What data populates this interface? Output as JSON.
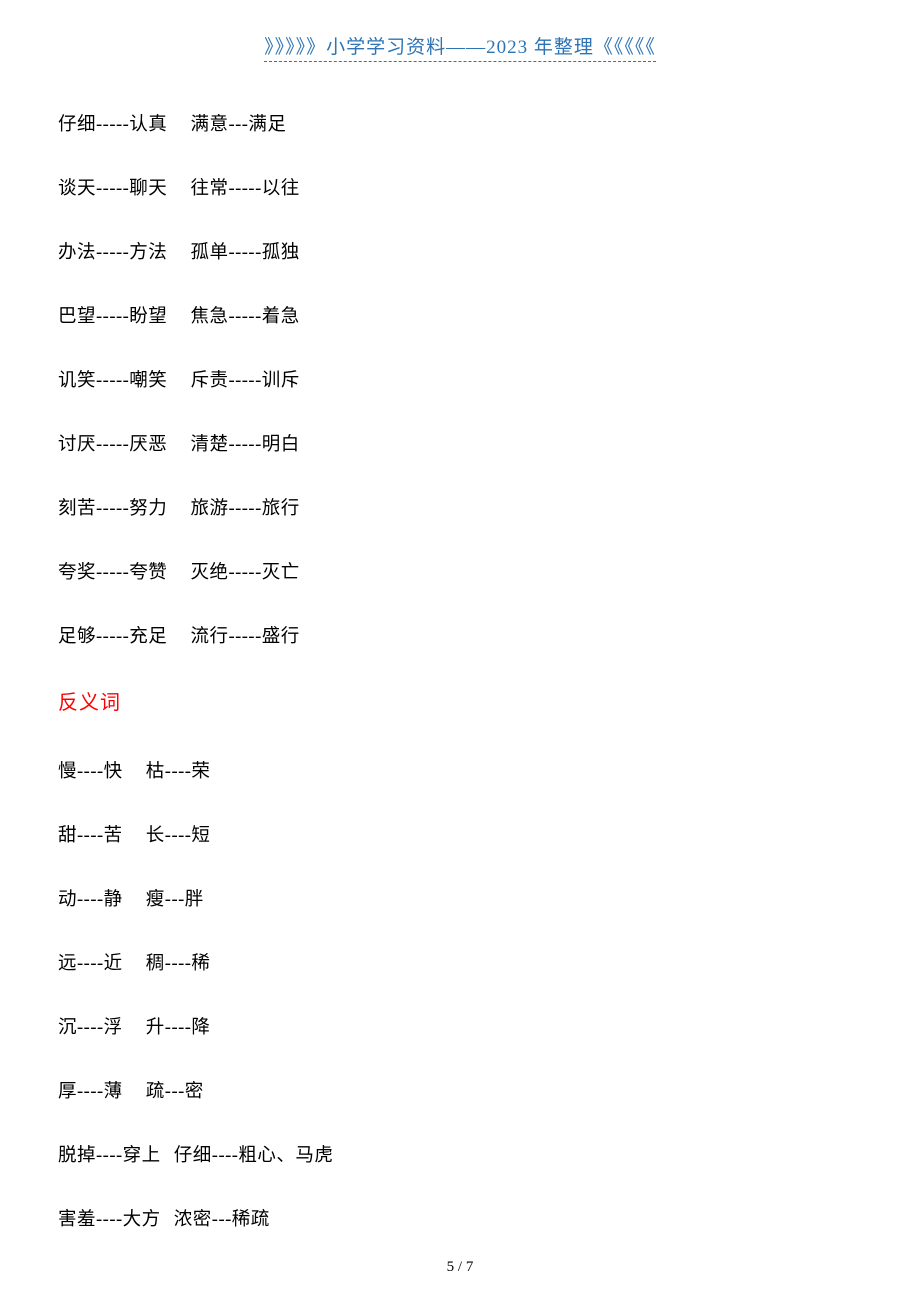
{
  "header": "》》》》》小学学习资料——2023 年整理《《《《《",
  "synonym_lines": [
    {
      "a": "仔细-----认真",
      "b": "满意---满足"
    },
    {
      "a": "谈天-----聊天",
      "b": "往常-----以往"
    },
    {
      "a": "办法-----方法",
      "b": "孤单-----孤独"
    },
    {
      "a": "巴望-----盼望",
      "b": "焦急-----着急"
    },
    {
      "a": "讥笑-----嘲笑",
      "b": "斥责-----训斥"
    },
    {
      "a": "讨厌-----厌恶",
      "b": "清楚-----明白"
    },
    {
      "a": "刻苦-----努力",
      "b": "旅游-----旅行"
    },
    {
      "a": "夸奖-----夸赞",
      "b": "灭绝-----灭亡"
    },
    {
      "a": "足够-----充足",
      "b": "流行-----盛行"
    }
  ],
  "section_heading": "反义词",
  "antonym_lines": [
    {
      "a": "慢----快",
      "b": "枯----荣"
    },
    {
      "a": "甜----苦",
      "b": "长----短"
    },
    {
      "a": "动----静",
      "b": "瘦---胖"
    },
    {
      "a": "远----近",
      "b": "稠----稀"
    },
    {
      "a": "沉----浮",
      "b": "升----降"
    },
    {
      "a": "厚----薄",
      "b": "疏---密"
    },
    {
      "a": "脱掉----穿上",
      "b": "仔细----粗心、马虎"
    },
    {
      "a": "害羞----大方",
      "b": "浓密---稀疏"
    }
  ],
  "page_num": "5 / 7"
}
